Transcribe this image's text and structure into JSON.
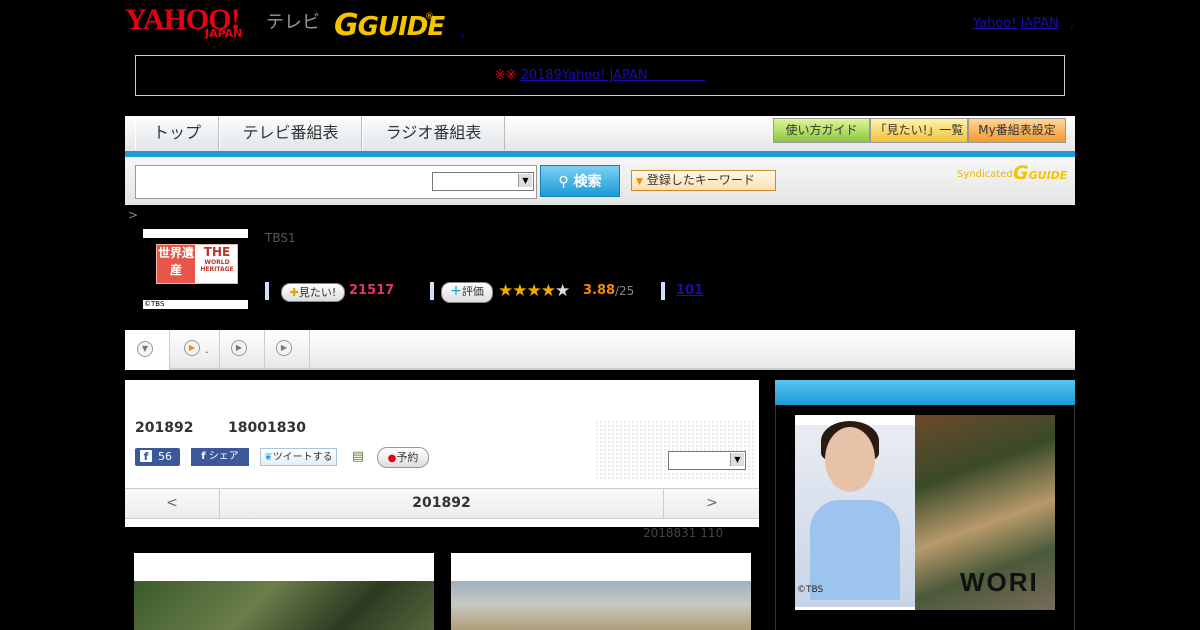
{
  "header": {
    "yahoo_logo": "YAHOO!",
    "yahoo_sub": "JAPAN",
    "tv_label": "テレビ",
    "gguide_logo": "GUIDE",
    "gguide_reg": "®",
    "dot": ",",
    "yahoo_japan_link": "Yahoo! JAPAN",
    "trailing_dot": ","
  },
  "notice": {
    "mark": "※※",
    "link_text": "20189Yahoo! JAPAN"
  },
  "nav": {
    "tabs": [
      "トップ",
      "テレビ番組表",
      "ラジオ番組表"
    ],
    "buttons": [
      "使い方ガイド",
      "「見たい!」一覧",
      "My番組表設定"
    ]
  },
  "search": {
    "button_label": "検索",
    "keyword_button": "登録したキーワード",
    "syndicated": "Syndicated",
    "syndicated_logo": "GUIDE"
  },
  "program": {
    "breadcrumb": ">",
    "thumb_red": "世界遺産",
    "thumb_the": "THE",
    "thumb_world": "WORLD HERITAGE",
    "thumb_credit": "©TBS",
    "channel": "TBS1",
    "want_label": "見たい!",
    "want_count": "21517",
    "rate_label": "評価",
    "stars_on": "★★★★",
    "stars_off": "★",
    "rating": 3.88,
    "score": "3.88",
    "score_total": "/25",
    "reviews": "101"
  },
  "tabstrip": {
    "icons": [
      "chevron-down",
      "play",
      "play",
      "play"
    ],
    "tab1_label": "."
  },
  "main": {
    "air_date": "201892",
    "air_time": "18001830",
    "fb_count": "56",
    "share_label": "シェア",
    "tweet_label": "ツイートする",
    "reserve_label": "予約",
    "datenav_prev": "<",
    "datenav_date": "201892",
    "datenav_next": ">",
    "info_line": "2018831  110"
  },
  "sidebar": {
    "ad_text": "WORI",
    "ad_copy": "©TBS"
  },
  "colors": {
    "accent_blue": "#1f9ad6",
    "yahoo_red": "#e60012",
    "gguide_yellow": "#f5c400",
    "want_pink": "#e8336f",
    "star_orange": "#f5a800"
  }
}
